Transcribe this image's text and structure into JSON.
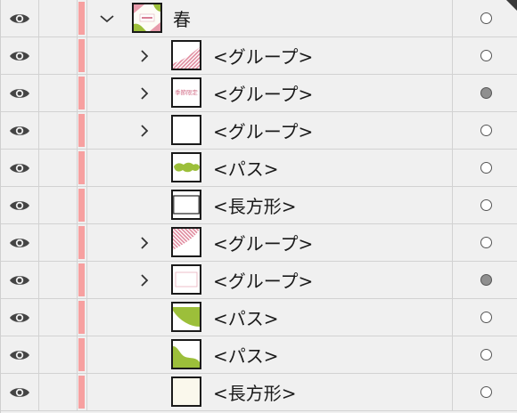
{
  "layers": [
    {
      "name": "春",
      "expanded": true,
      "level": 0,
      "has_children": true,
      "thumb": "spring-artboard",
      "target_selected": false
    },
    {
      "name": "<グループ>",
      "expanded": false,
      "level": 1,
      "has_children": true,
      "thumb": "pink-stripe-wedge",
      "target_selected": false
    },
    {
      "name": "<グループ>",
      "expanded": false,
      "level": 1,
      "has_children": true,
      "thumb": "seasonal-text",
      "thumb_text": "季節限定",
      "target_selected": true
    },
    {
      "name": "<グループ>",
      "expanded": false,
      "level": 1,
      "has_children": true,
      "thumb": "blank",
      "target_selected": false
    },
    {
      "name": "<パス>",
      "level": 1,
      "has_children": false,
      "thumb": "green-blob",
      "target_selected": false
    },
    {
      "name": "<長方形>",
      "level": 1,
      "has_children": false,
      "thumb": "outlined-rect",
      "target_selected": false
    },
    {
      "name": "<グループ>",
      "expanded": false,
      "level": 1,
      "has_children": true,
      "thumb": "pink-stripe-corner",
      "target_selected": false
    },
    {
      "name": "<グループ>",
      "expanded": false,
      "level": 1,
      "has_children": true,
      "thumb": "pink-frame",
      "target_selected": true
    },
    {
      "name": "<パス>",
      "level": 1,
      "has_children": false,
      "thumb": "green-leaf",
      "target_selected": false
    },
    {
      "name": "<パス>",
      "level": 1,
      "has_children": false,
      "thumb": "green-wave",
      "target_selected": false
    },
    {
      "name": "<長方形>",
      "level": 1,
      "has_children": false,
      "thumb": "cream-rect",
      "target_selected": false
    }
  ],
  "layer_color": "#f7a0a0",
  "icons": {
    "visibility": "eye-icon",
    "collapsed": "chevron-right-icon",
    "expanded": "chevron-down-icon",
    "target": "target-circle-icon"
  }
}
